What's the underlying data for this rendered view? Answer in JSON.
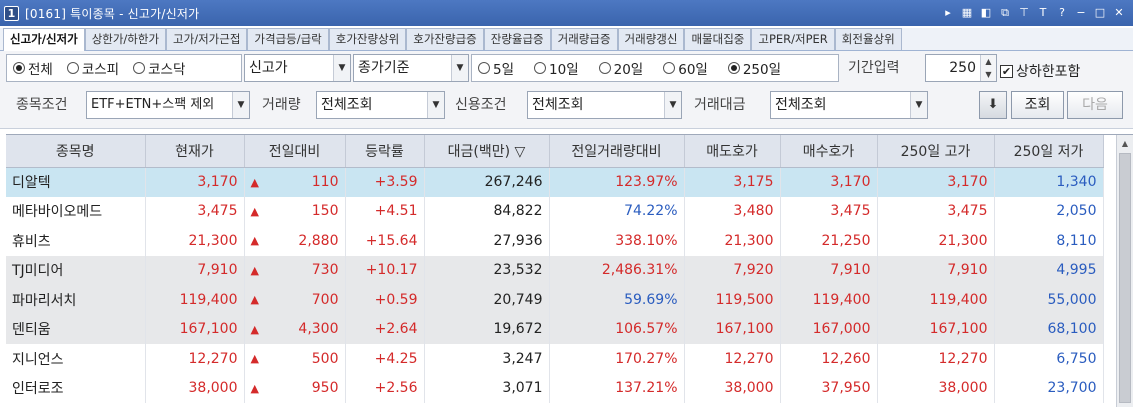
{
  "window": {
    "badge": "1",
    "title": "[0161] 특이종목 - 신고가/신저가",
    "controls": [
      "▸",
      "▦",
      "◧",
      "⧉",
      "⊤",
      "T",
      "?",
      "−",
      "□",
      "✕"
    ]
  },
  "tabs": [
    {
      "label": "신고가/신저가",
      "active": true
    },
    {
      "label": "상한가/하한가"
    },
    {
      "label": "고가/저가근접"
    },
    {
      "label": "가격급등/급락"
    },
    {
      "label": "호가잔량상위"
    },
    {
      "label": "호가잔량급증"
    },
    {
      "label": "잔량율급증"
    },
    {
      "label": "거래량급증"
    },
    {
      "label": "거래량갱신"
    },
    {
      "label": "매물대집중"
    },
    {
      "label": "고PER/저PER"
    },
    {
      "label": "회전율상위"
    }
  ],
  "market_radios": [
    {
      "label": "전체",
      "checked": true
    },
    {
      "label": "코스피",
      "checked": false
    },
    {
      "label": "코스닥",
      "checked": false
    }
  ],
  "type_select": "신고가",
  "price_basis_select": "종가기준",
  "period_radios": [
    {
      "label": "5일",
      "checked": false
    },
    {
      "label": "10일",
      "checked": false
    },
    {
      "label": "20일",
      "checked": false
    },
    {
      "label": "60일",
      "checked": false
    },
    {
      "label": "250일",
      "checked": true
    }
  ],
  "period_input_label": "기간입력",
  "period_input_value": "250",
  "include_limit_label": "상하한포함",
  "include_limit_checked": "✔",
  "stock_condition_label": "종목조건",
  "stock_condition_value": "ETF+ETN+스팩 제외",
  "volume_label": "거래량",
  "volume_value": "전체조회",
  "credit_label": "신용조건",
  "credit_value": "전체조회",
  "amount_label": "거래대금",
  "amount_value": "전체조회",
  "buttons": {
    "settings_icon": "⬇",
    "search": "조회",
    "next": "다음"
  },
  "columns": [
    "종목명",
    "현재가",
    "전일대비",
    "등락률",
    "대금(백만) ▽",
    "전일거래량대비",
    "매도호가",
    "매수호가",
    "250일 고가",
    "250일 저가"
  ],
  "rows": [
    {
      "name": "디알텍",
      "price": "3,170",
      "change": "110",
      "rate": "+3.59",
      "amount": "267,246",
      "vol_ratio": "123.97%",
      "ask": "3,175",
      "bid": "3,170",
      "high": "3,170",
      "low": "1,340",
      "style": "sel",
      "ratio_color": "red"
    },
    {
      "name": "메타바이오메드",
      "price": "3,475",
      "change": "150",
      "rate": "+4.51",
      "amount": "84,822",
      "vol_ratio": "74.22%",
      "ask": "3,480",
      "bid": "3,475",
      "high": "3,475",
      "low": "2,050",
      "style": "white",
      "ratio_color": "blue"
    },
    {
      "name": "휴비츠",
      "price": "21,300",
      "change": "2,880",
      "rate": "+15.64",
      "amount": "27,936",
      "vol_ratio": "338.10%",
      "ask": "21,300",
      "bid": "21,250",
      "high": "21,300",
      "low": "8,110",
      "style": "white",
      "ratio_color": "red"
    },
    {
      "name": "TJ미디어",
      "price": "7,910",
      "change": "730",
      "rate": "+10.17",
      "amount": "23,532",
      "vol_ratio": "2,486.31%",
      "ask": "7,920",
      "bid": "7,910",
      "high": "7,910",
      "low": "4,995",
      "style": "gray",
      "ratio_color": "red"
    },
    {
      "name": "파마리서치",
      "price": "119,400",
      "change": "700",
      "rate": "+0.59",
      "amount": "20,749",
      "vol_ratio": "59.69%",
      "ask": "119,500",
      "bid": "119,400",
      "high": "119,400",
      "low": "55,000",
      "style": "gray",
      "ratio_color": "blue"
    },
    {
      "name": "덴티움",
      "price": "167,100",
      "change": "4,300",
      "rate": "+2.64",
      "amount": "19,672",
      "vol_ratio": "106.57%",
      "ask": "167,100",
      "bid": "167,000",
      "high": "167,100",
      "low": "68,100",
      "style": "gray",
      "ratio_color": "red"
    },
    {
      "name": "지니언스",
      "price": "12,270",
      "change": "500",
      "rate": "+4.25",
      "amount": "3,247",
      "vol_ratio": "170.27%",
      "ask": "12,270",
      "bid": "12,260",
      "high": "12,270",
      "low": "6,750",
      "style": "white",
      "ratio_color": "red"
    },
    {
      "name": "인터로조",
      "price": "38,000",
      "change": "950",
      "rate": "+2.56",
      "amount": "3,071",
      "vol_ratio": "137.21%",
      "ask": "38,000",
      "bid": "37,950",
      "high": "38,000",
      "low": "23,700",
      "style": "white",
      "ratio_color": "red"
    }
  ],
  "colors": {
    "up": "#d42a2a",
    "down": "#2a5cbf",
    "title_bar": "#3f69b3",
    "selected_row": "#c9e5f2"
  }
}
